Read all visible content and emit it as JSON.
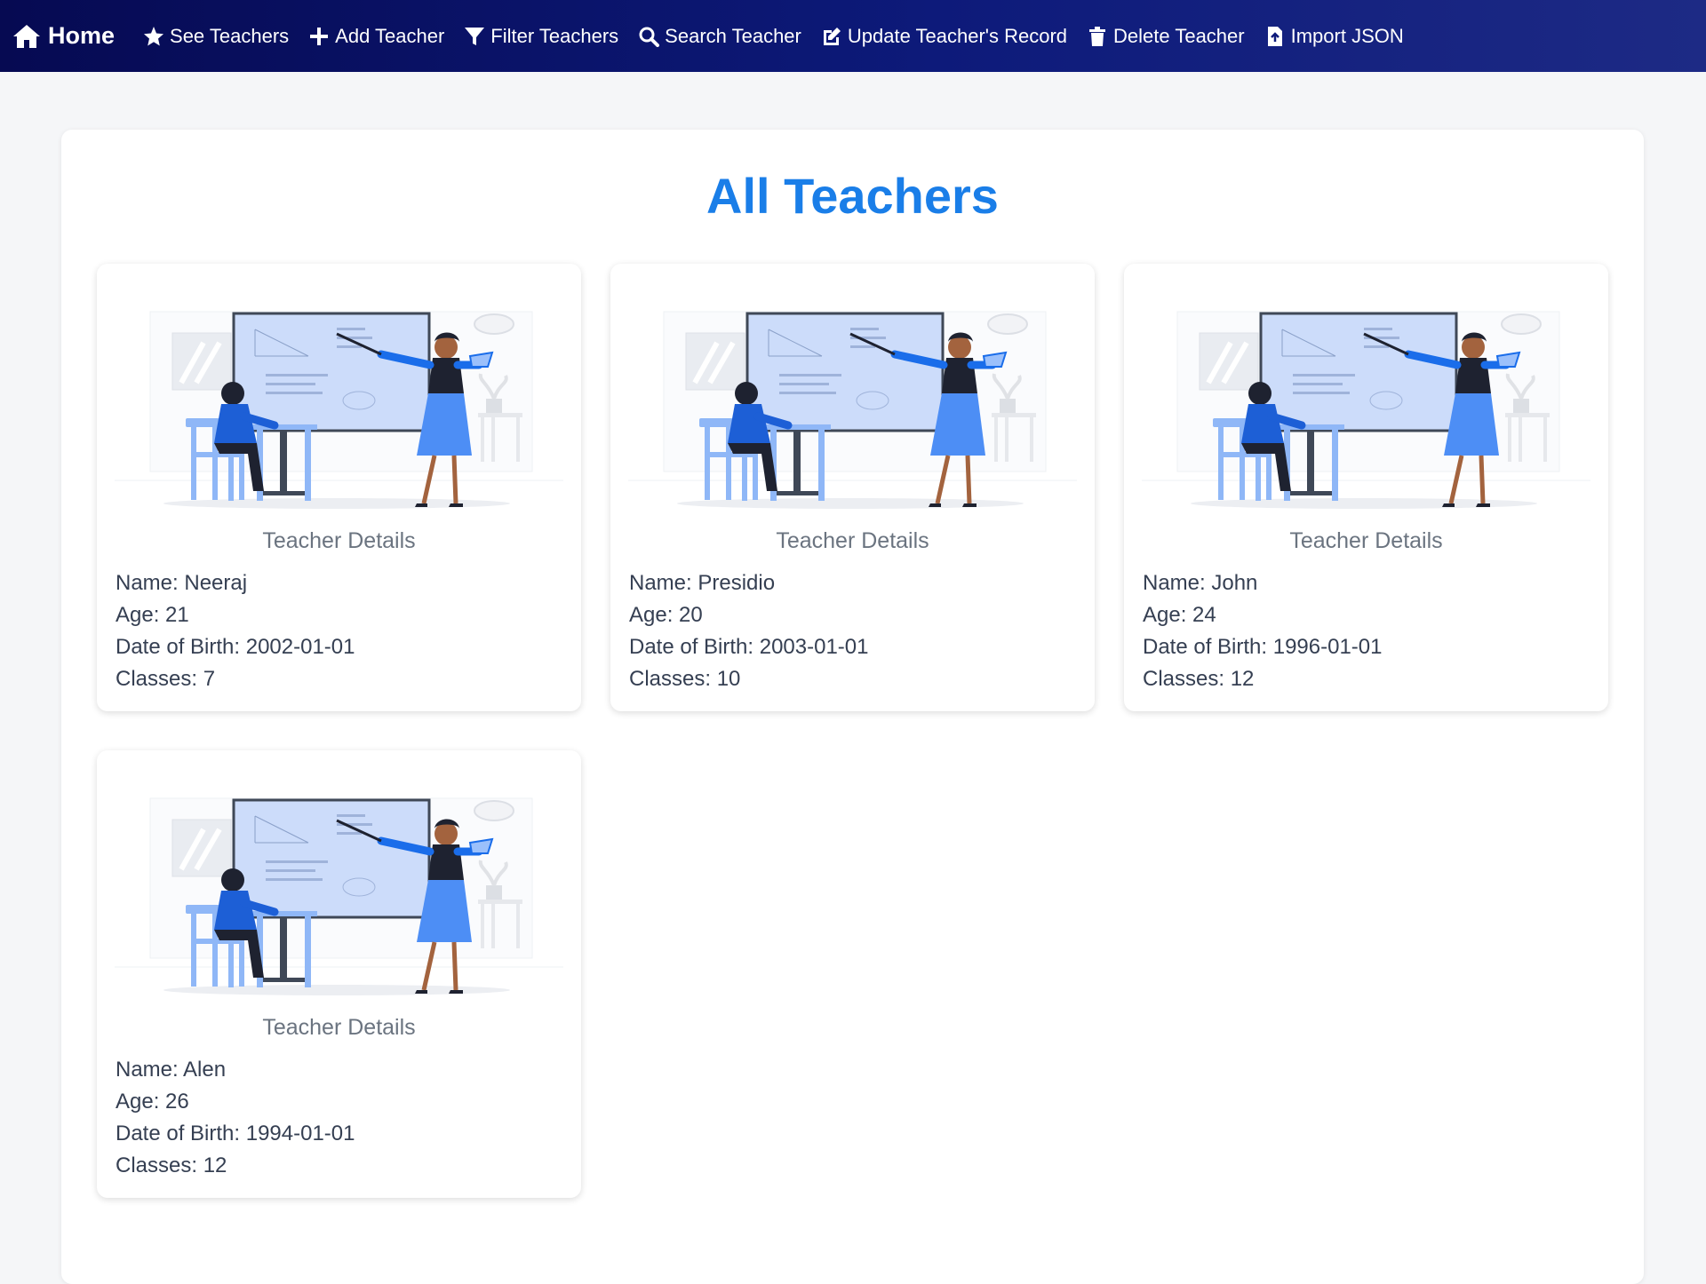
{
  "nav": {
    "home": "Home",
    "see_teachers": "See Teachers",
    "add_teacher": "Add Teacher",
    "filter_teachers": "Filter Teachers",
    "search_teacher": "Search Teacher",
    "update_record": "Update Teacher's Record",
    "delete_teacher": "Delete Teacher",
    "import_json": "Import JSON"
  },
  "page": {
    "title": "All Teachers"
  },
  "colors": {
    "accent": "#1a7ee8",
    "nav_dark": "#060a52",
    "illustration_blue": "#4d8ef5"
  },
  "teachers": [
    {
      "heading": "Teacher Details",
      "name": "Name: Neeraj",
      "age": "Age: 21",
      "dob": "Date of Birth: 2002-01-01",
      "classes": "Classes: 7"
    },
    {
      "heading": "Teacher Details",
      "name": "Name: Presidio",
      "age": "Age: 20",
      "dob": "Date of Birth: 2003-01-01",
      "classes": "Classes: 10"
    },
    {
      "heading": "Teacher Details",
      "name": "Name: John",
      "age": "Age: 24",
      "dob": "Date of Birth: 1996-01-01",
      "classes": "Classes: 12"
    },
    {
      "heading": "Teacher Details",
      "name": "Name: Alen",
      "age": "Age: 26",
      "dob": "Date of Birth: 1994-01-01",
      "classes": "Classes: 12"
    }
  ]
}
